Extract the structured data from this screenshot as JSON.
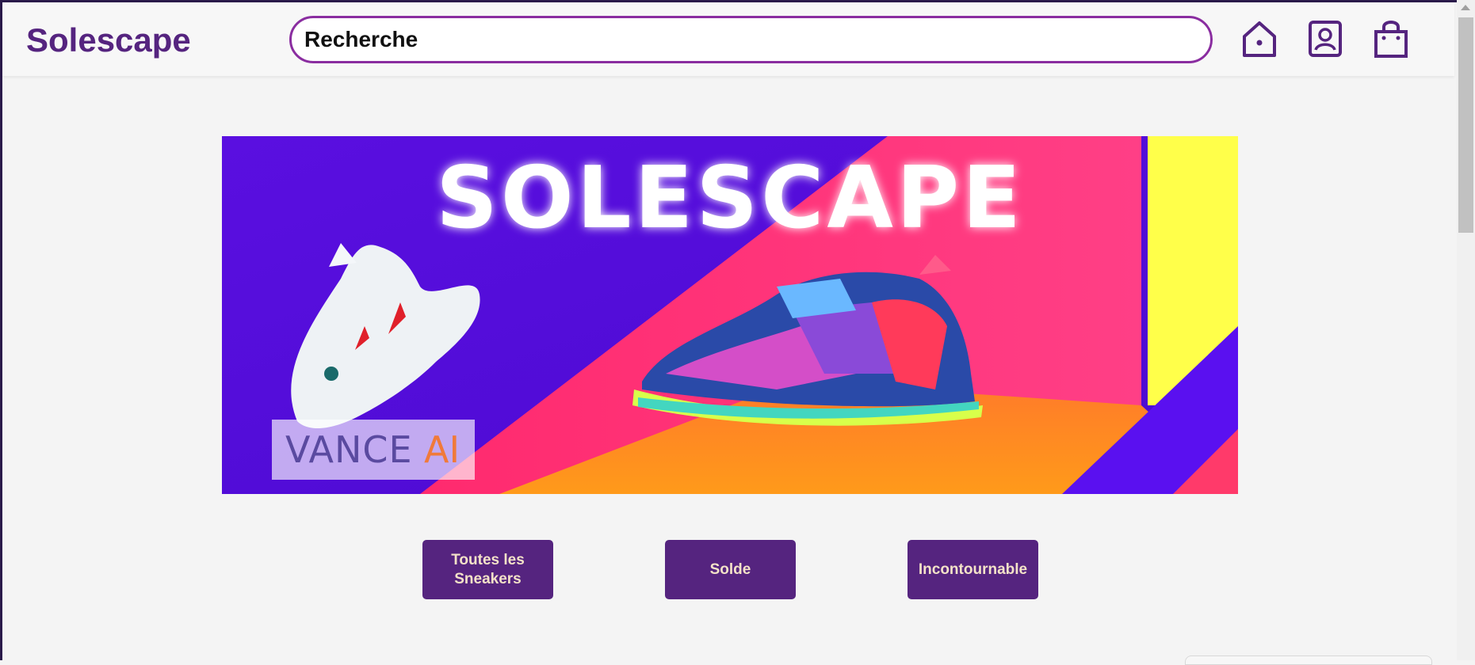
{
  "header": {
    "brand": "Solescape",
    "search_value": "Recherche",
    "icons": [
      "home-icon",
      "profile-icon",
      "shopping-bag-icon"
    ]
  },
  "banner": {
    "title": "SOLESCAPE",
    "watermark_left": "VANCE",
    "watermark_right": "AI"
  },
  "categories": [
    {
      "label": "Toutes les Sneakers"
    },
    {
      "label": "Solde"
    },
    {
      "label": "Incontournable"
    }
  ],
  "colors": {
    "brand": "#55247f",
    "search_border": "#8a2da0",
    "button_text": "#f4e2c8",
    "background": "#f4f4f4"
  }
}
